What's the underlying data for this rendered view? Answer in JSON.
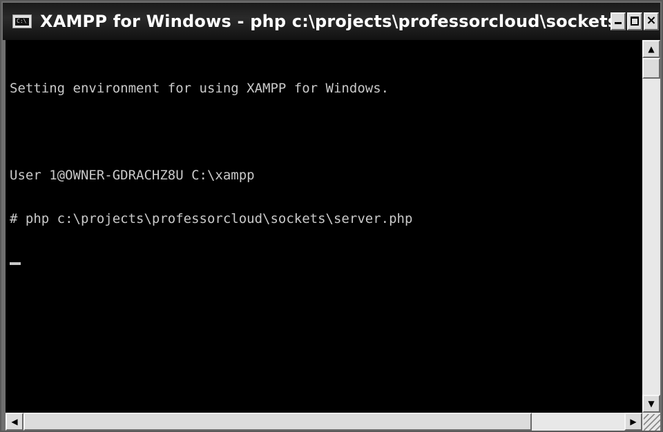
{
  "window": {
    "title": "XAMPP for Windows - php c:\\projects\\professorcloud\\sockets\\ser...",
    "icon": "C:\\"
  },
  "console": {
    "lines": [
      "Setting environment for using XAMPP for Windows.",
      "",
      "User 1@OWNER-GDRACHZ8U C:\\xampp",
      "# php c:\\projects\\professorcloud\\sockets\\server.php"
    ]
  },
  "controls": {
    "minimize_icon": "minimize-icon",
    "maximize_icon": "maximize-icon",
    "close_label": "×"
  },
  "scroll": {
    "up_arrow": "▲",
    "down_arrow": "▼",
    "left_arrow": "◀",
    "right_arrow": "▶"
  }
}
